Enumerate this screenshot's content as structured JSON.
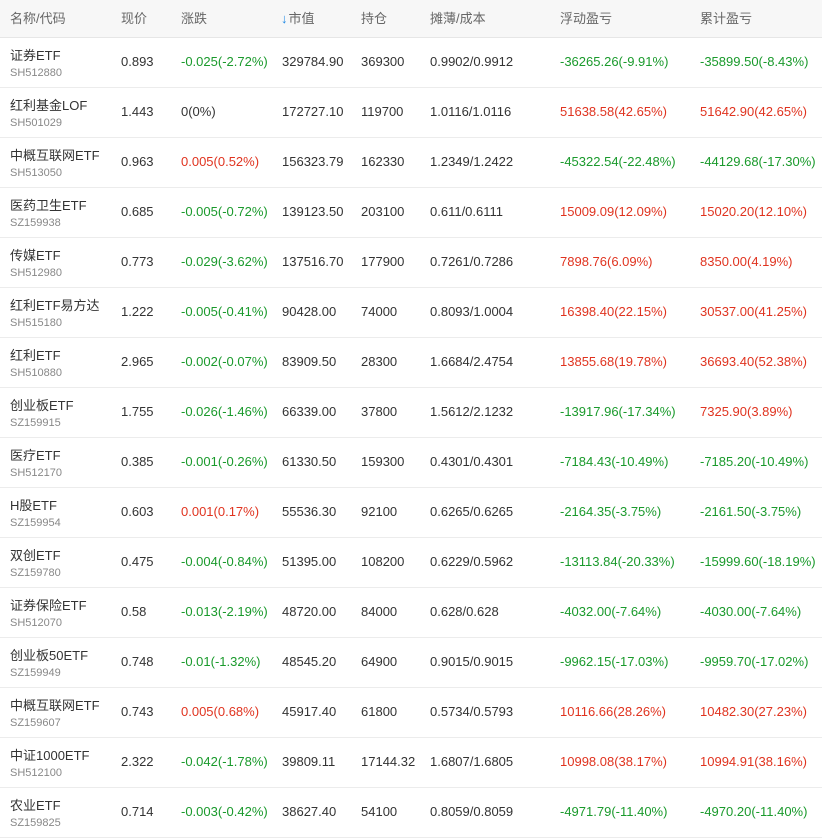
{
  "colors": {
    "up": "#e0331f",
    "down": "#1a9a2c",
    "flat": "#333333",
    "sort_arrow": "#1e88e5"
  },
  "header": {
    "name_code": "名称/代码",
    "price": "现价",
    "change": "涨跌",
    "sort_arrow": "↓",
    "market_value": "市值",
    "holding": "持仓",
    "cost": "摊薄/成本",
    "float_pl": "浮动盈亏",
    "total_pl": "累计盈亏"
  },
  "rows": [
    {
      "name": "证券ETF",
      "code": "SH512880",
      "price": "0.893",
      "change": "-0.025(-2.72%)",
      "change_dir": "down",
      "market_value": "329784.90",
      "holding": "369300",
      "cost": "0.9902/0.9912",
      "float_pl": "-36265.26(-9.91%)",
      "float_dir": "down",
      "total_pl": "-35899.50(-8.43%)",
      "total_dir": "down"
    },
    {
      "name": "红利基金LOF",
      "code": "SH501029",
      "price": "1.443",
      "change": "0(0%)",
      "change_dir": "flat",
      "market_value": "172727.10",
      "holding": "119700",
      "cost": "1.0116/1.0116",
      "float_pl": "51638.58(42.65%)",
      "float_dir": "up",
      "total_pl": "51642.90(42.65%)",
      "total_dir": "up"
    },
    {
      "name": "中概互联网ETF",
      "code": "SH513050",
      "price": "0.963",
      "change": "0.005(0.52%)",
      "change_dir": "up",
      "market_value": "156323.79",
      "holding": "162330",
      "cost": "1.2349/1.2422",
      "float_pl": "-45322.54(-22.48%)",
      "float_dir": "down",
      "total_pl": "-44129.68(-17.30%)",
      "total_dir": "down"
    },
    {
      "name": "医药卫生ETF",
      "code": "SZ159938",
      "price": "0.685",
      "change": "-0.005(-0.72%)",
      "change_dir": "down",
      "market_value": "139123.50",
      "holding": "203100",
      "cost": "0.611/0.6111",
      "float_pl": "15009.09(12.09%)",
      "float_dir": "up",
      "total_pl": "15020.20(12.10%)",
      "total_dir": "up"
    },
    {
      "name": "传媒ETF",
      "code": "SH512980",
      "price": "0.773",
      "change": "-0.029(-3.62%)",
      "change_dir": "down",
      "market_value": "137516.70",
      "holding": "177900",
      "cost": "0.7261/0.7286",
      "float_pl": "7898.76(6.09%)",
      "float_dir": "up",
      "total_pl": "8350.00(4.19%)",
      "total_dir": "up"
    },
    {
      "name": "红利ETF易方达",
      "code": "SH515180",
      "price": "1.222",
      "change": "-0.005(-0.41%)",
      "change_dir": "down",
      "market_value": "90428.00",
      "holding": "74000",
      "cost": "0.8093/1.0004",
      "float_pl": "16398.40(22.15%)",
      "float_dir": "up",
      "total_pl": "30537.00(41.25%)",
      "total_dir": "up"
    },
    {
      "name": "红利ETF",
      "code": "SH510880",
      "price": "2.965",
      "change": "-0.002(-0.07%)",
      "change_dir": "down",
      "market_value": "83909.50",
      "holding": "28300",
      "cost": "1.6684/2.4754",
      "float_pl": "13855.68(19.78%)",
      "float_dir": "up",
      "total_pl": "36693.40(52.38%)",
      "total_dir": "up"
    },
    {
      "name": "创业板ETF",
      "code": "SZ159915",
      "price": "1.755",
      "change": "-0.026(-1.46%)",
      "change_dir": "down",
      "market_value": "66339.00",
      "holding": "37800",
      "cost": "1.5612/2.1232",
      "float_pl": "-13917.96(-17.34%)",
      "float_dir": "down",
      "total_pl": "7325.90(3.89%)",
      "total_dir": "up"
    },
    {
      "name": "医疗ETF",
      "code": "SH512170",
      "price": "0.385",
      "change": "-0.001(-0.26%)",
      "change_dir": "down",
      "market_value": "61330.50",
      "holding": "159300",
      "cost": "0.4301/0.4301",
      "float_pl": "-7184.43(-10.49%)",
      "float_dir": "down",
      "total_pl": "-7185.20(-10.49%)",
      "total_dir": "down"
    },
    {
      "name": "H股ETF",
      "code": "SZ159954",
      "price": "0.603",
      "change": "0.001(0.17%)",
      "change_dir": "up",
      "market_value": "55536.30",
      "holding": "92100",
      "cost": "0.6265/0.6265",
      "float_pl": "-2164.35(-3.75%)",
      "float_dir": "down",
      "total_pl": "-2161.50(-3.75%)",
      "total_dir": "down"
    },
    {
      "name": "双创ETF",
      "code": "SZ159780",
      "price": "0.475",
      "change": "-0.004(-0.84%)",
      "change_dir": "down",
      "market_value": "51395.00",
      "holding": "108200",
      "cost": "0.6229/0.5962",
      "float_pl": "-13113.84(-20.33%)",
      "float_dir": "down",
      "total_pl": "-15999.60(-18.19%)",
      "total_dir": "down"
    },
    {
      "name": "证券保险ETF",
      "code": "SH512070",
      "price": "0.58",
      "change": "-0.013(-2.19%)",
      "change_dir": "down",
      "market_value": "48720.00",
      "holding": "84000",
      "cost": "0.628/0.628",
      "float_pl": "-4032.00(-7.64%)",
      "float_dir": "down",
      "total_pl": "-4030.00(-7.64%)",
      "total_dir": "down"
    },
    {
      "name": "创业板50ETF",
      "code": "SZ159949",
      "price": "0.748",
      "change": "-0.01(-1.32%)",
      "change_dir": "down",
      "market_value": "48545.20",
      "holding": "64900",
      "cost": "0.9015/0.9015",
      "float_pl": "-9962.15(-17.03%)",
      "float_dir": "down",
      "total_pl": "-9959.70(-17.02%)",
      "total_dir": "down"
    },
    {
      "name": "中概互联网ETF",
      "code": "SZ159607",
      "price": "0.743",
      "change": "0.005(0.68%)",
      "change_dir": "up",
      "market_value": "45917.40",
      "holding": "61800",
      "cost": "0.5734/0.5793",
      "float_pl": "10116.66(28.26%)",
      "float_dir": "up",
      "total_pl": "10482.30(27.23%)",
      "total_dir": "up"
    },
    {
      "name": "中证1000ETF",
      "code": "SH512100",
      "price": "2.322",
      "change": "-0.042(-1.78%)",
      "change_dir": "down",
      "market_value": "39809.11",
      "holding": "17144.32",
      "cost": "1.6807/1.6805",
      "float_pl": "10998.08(38.17%)",
      "float_dir": "up",
      "total_pl": "10994.91(38.16%)",
      "total_dir": "up"
    },
    {
      "name": "农业ETF",
      "code": "SZ159825",
      "price": "0.714",
      "change": "-0.003(-0.42%)",
      "change_dir": "down",
      "market_value": "38627.40",
      "holding": "54100",
      "cost": "0.8059/0.8059",
      "float_pl": "-4971.79(-11.40%)",
      "float_dir": "down",
      "total_pl": "-4970.20(-11.40%)",
      "total_dir": "down"
    }
  ]
}
